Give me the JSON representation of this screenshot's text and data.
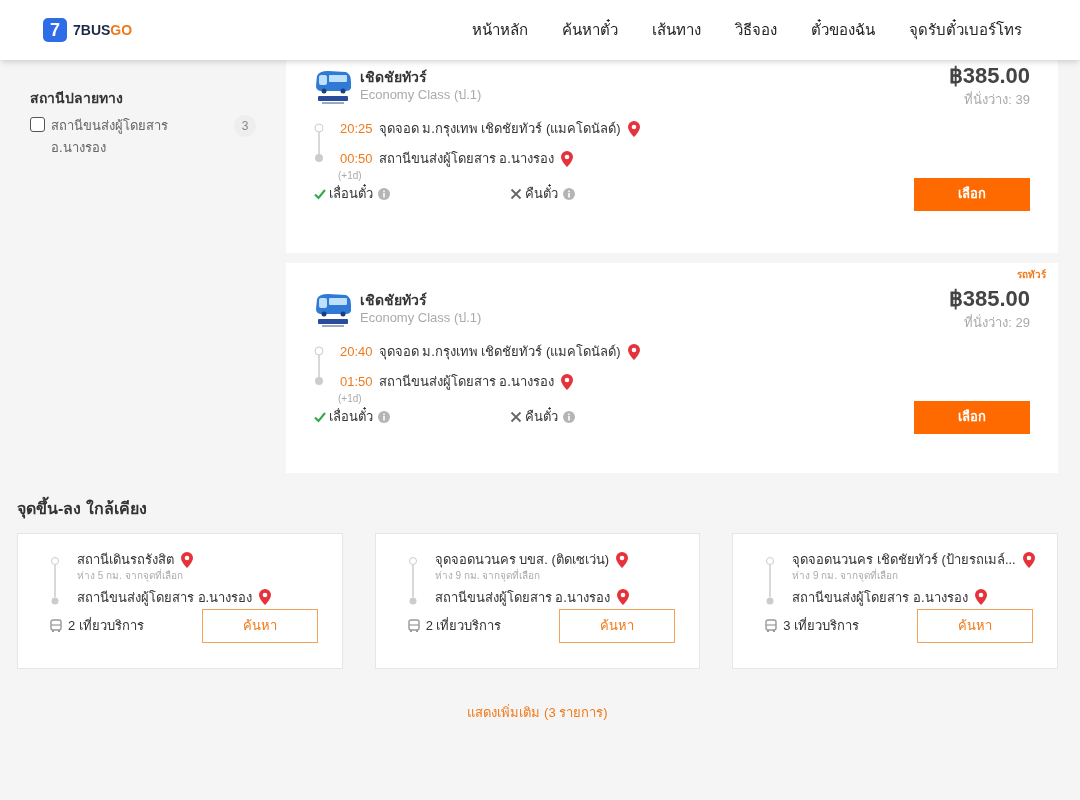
{
  "header": {
    "logo": {
      "glyph": "7",
      "main": "7BUS",
      "accent": "GO"
    },
    "nav": [
      "หน้าหลัก",
      "ค้นหาตั๋ว",
      "เส้นทาง",
      "วิธีจอง",
      "ตั๋วของฉัน",
      "จุดรับตั๋วเบอร์โทร"
    ]
  },
  "sidebar": {
    "section_title": "สถานีปลายทาง",
    "filters": [
      {
        "label": "สถานีขนส่งผู้โดยสาร อ.นางรอง",
        "count": "3",
        "checked": false
      }
    ]
  },
  "trips": [
    {
      "operator": "เชิดชัยทัวร์",
      "class": "Economy Class (ป.1)",
      "price": "฿385.00",
      "seats": "ที่นั่งว่าง: 39",
      "depart_time": "20:25",
      "depart_place": "จุดจอด ม.กรุงเทพ เชิดชัยทัวร์ (แมคโดนัลด์)",
      "arrive_time": "00:50",
      "arrive_place": "สถานีขนส่งผู้โดยสาร อ.นางรอง",
      "day_offset": "(+1d)",
      "features": [
        {
          "label": "เลื่อนตั๋ว",
          "available": true
        },
        {
          "label": "คืนตั๋ว",
          "available": false
        }
      ],
      "button": "เลือก"
    },
    {
      "tag": "รถทัวร์",
      "operator": "เชิดชัยทัวร์",
      "class": "Economy Class (ป.1)",
      "price": "฿385.00",
      "seats": "ที่นั่งว่าง: 29",
      "depart_time": "20:40",
      "depart_place": "จุดจอด ม.กรุงเทพ เชิดชัยทัวร์ (แมคโดนัลด์)",
      "arrive_time": "01:50",
      "arrive_place": "สถานีขนส่งผู้โดยสาร อ.นางรอง",
      "day_offset": "(+1d)",
      "features": [
        {
          "label": "เลื่อนตั๋ว",
          "available": true
        },
        {
          "label": "คืนตั๋ว",
          "available": false
        }
      ],
      "button": "เลือก"
    }
  ],
  "nearby": {
    "title": "จุดขึ้น-ลง ใกล้เคียง",
    "cards": [
      {
        "from": "สถานีเดินรถรังสิต",
        "distance": "ห่าง 5 กม. จากจุดที่เลือก",
        "to": "สถานีขนส่งผู้โดยสาร อ.นางรอง",
        "trips": "2 เที่ยวบริการ",
        "button": "ค้นหา"
      },
      {
        "from": "จุดจอดนวนคร บขส. (ติดเซเว่น)",
        "distance": "ห่าง 9 กม. จากจุดที่เลือก",
        "to": "สถานีขนส่งผู้โดยสาร อ.นางรอง",
        "trips": "2 เที่ยวบริการ",
        "button": "ค้นหา"
      },
      {
        "from": "จุดจอดนวนคร เชิดชัยทัวร์ (ป้ายรถเมล์...",
        "distance": "ห่าง 9 กม. จากจุดที่เลือก",
        "to": "สถานีขนส่งผู้โดยสาร อ.นางรอง",
        "trips": "3 เที่ยวบริการ",
        "button": "ค้นหา"
      }
    ],
    "more": "แสดงเพิ่มเติม (3 รายการ)"
  }
}
